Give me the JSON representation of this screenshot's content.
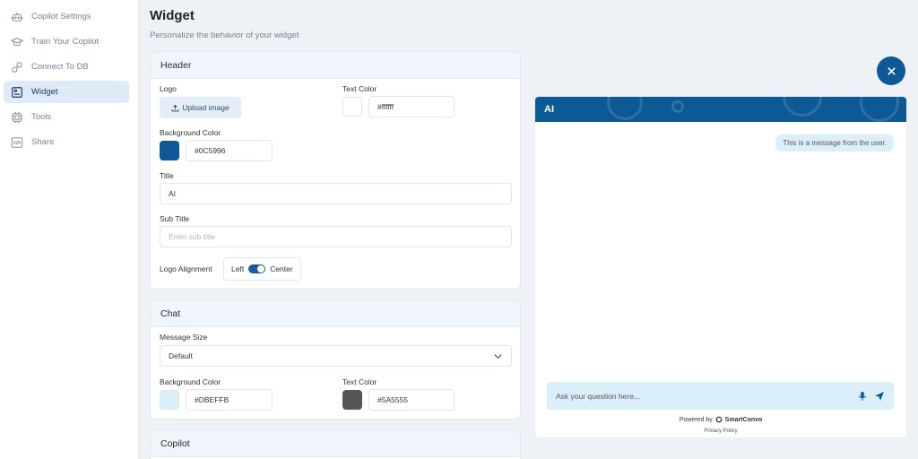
{
  "sidebar": {
    "items": [
      {
        "label": "Copilot Settings",
        "icon": "robot-icon"
      },
      {
        "label": "Train Your Copilot",
        "icon": "graduation-cap-icon"
      },
      {
        "label": "Connect To DB",
        "icon": "link-icon"
      },
      {
        "label": "Widget",
        "icon": "widget-icon",
        "active": true
      },
      {
        "label": "Tools",
        "icon": "chip-icon"
      },
      {
        "label": "Share",
        "icon": "code-icon"
      }
    ]
  },
  "page": {
    "title": "Widget",
    "subtitle": "Personalize the behavior of your widget"
  },
  "header_section": {
    "title": "Header",
    "logo_label": "Logo",
    "upload_label": "Upload image",
    "text_color_label": "Text Color",
    "text_color_value": "#ffffff",
    "bg_color_label": "Background Color",
    "bg_color_value": "#0C5996",
    "title_label": "Title",
    "title_value": "AI",
    "subtitle_label": "Sub Title",
    "subtitle_placeholder": "Enter sub title",
    "alignment_label": "Logo Alignment",
    "align_left": "Left",
    "align_center": "Center"
  },
  "chat_section": {
    "title": "Chat",
    "message_size_label": "Message Size",
    "message_size_value": "Default",
    "bg_color_label": "Background Color",
    "bg_color_value": "#DBEFFB",
    "text_color_label": "Text Color",
    "text_color_value": "#5A5555"
  },
  "copilot_section": {
    "title": "Copilot"
  },
  "preview": {
    "header_title": "AI",
    "user_message": "This is a message from the user.",
    "ask_placeholder": "Ask your question here...",
    "powered_by": "Powered by",
    "brand": "SmartConvo",
    "privacy": "Privacy Policy"
  },
  "colors": {
    "accent": "#0C5996",
    "chat_bg": "#DBEFFB",
    "chat_text": "#5A5555",
    "active_nav_bg": "#DFEAF8"
  }
}
